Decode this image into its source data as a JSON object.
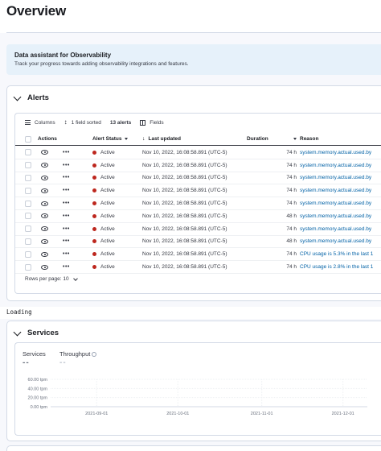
{
  "page": {
    "title": "Overview"
  },
  "assistant": {
    "title": "Data assistant for Observability",
    "description": "Track your progress towards adding observability integrations and features."
  },
  "alerts": {
    "title": "Alerts",
    "toolbar": {
      "columns": "Columns",
      "sorted": "1 field sorted",
      "count": "13 alerts",
      "fields": "Fields"
    },
    "headers": {
      "actions": "Actions",
      "status": "Alert Status",
      "updated": "Last updated",
      "duration": "Duration",
      "reason": "Reason"
    },
    "rows": [
      {
        "status": "Active",
        "updated": "Nov 10, 2022, 16:08:58.891 (UTC-5)",
        "duration": "74 h",
        "reason": "system.memory.actual.used.by"
      },
      {
        "status": "Active",
        "updated": "Nov 10, 2022, 16:08:58.891 (UTC-5)",
        "duration": "74 h",
        "reason": "system.memory.actual.used.by"
      },
      {
        "status": "Active",
        "updated": "Nov 10, 2022, 16:08:58.891 (UTC-5)",
        "duration": "74 h",
        "reason": "system.memory.actual.used.by"
      },
      {
        "status": "Active",
        "updated": "Nov 10, 2022, 16:08:58.891 (UTC-5)",
        "duration": "74 h",
        "reason": "system.memory.actual.used.by"
      },
      {
        "status": "Active",
        "updated": "Nov 10, 2022, 16:08:58.891 (UTC-5)",
        "duration": "74 h",
        "reason": "system.memory.actual.used.by"
      },
      {
        "status": "Active",
        "updated": "Nov 10, 2022, 16:08:58.891 (UTC-5)",
        "duration": "48 h",
        "reason": "system.memory.actual.used.by"
      },
      {
        "status": "Active",
        "updated": "Nov 10, 2022, 16:08:58.891 (UTC-5)",
        "duration": "74 h",
        "reason": "system.memory.actual.used.by"
      },
      {
        "status": "Active",
        "updated": "Nov 10, 2022, 16:08:58.891 (UTC-5)",
        "duration": "48 h",
        "reason": "system.memory.actual.used.by"
      },
      {
        "status": "Active",
        "updated": "Nov 10, 2022, 16:08:58.891 (UTC-5)",
        "duration": "74 h",
        "reason": "CPU usage is 5.3% in the last 1"
      },
      {
        "status": "Active",
        "updated": "Nov 10, 2022, 16:08:58.891 (UTC-5)",
        "duration": "74 h",
        "reason": "CPU usage is 2.8% in the last 1"
      }
    ],
    "rows_per_page": "Rows per page: 10"
  },
  "loading": "Loading",
  "services": {
    "title": "Services",
    "stats": [
      {
        "label": "Services",
        "value": "--"
      },
      {
        "label": "Throughput",
        "value": "--"
      }
    ]
  },
  "colors": {
    "active_dot": "#bd271e",
    "link": "#0061a6",
    "panel_bg": "#f7f8fc",
    "callout_bg": "#e6f1fa"
  },
  "chart_data": {
    "type": "line",
    "y_ticks": [
      "60.00 tpm",
      "40.00 tpm",
      "20.00 tpm",
      "0.00 tpm"
    ],
    "y_values": [
      60,
      40,
      20,
      0
    ],
    "x_ticks": [
      "2021-09-01",
      "2021-10-01",
      "2021-11-01",
      "2021-12-01"
    ],
    "x_range": [
      "2021-08-15",
      "2021-12-10"
    ],
    "ylim": [
      0,
      60
    ],
    "series": [],
    "grid": true
  }
}
